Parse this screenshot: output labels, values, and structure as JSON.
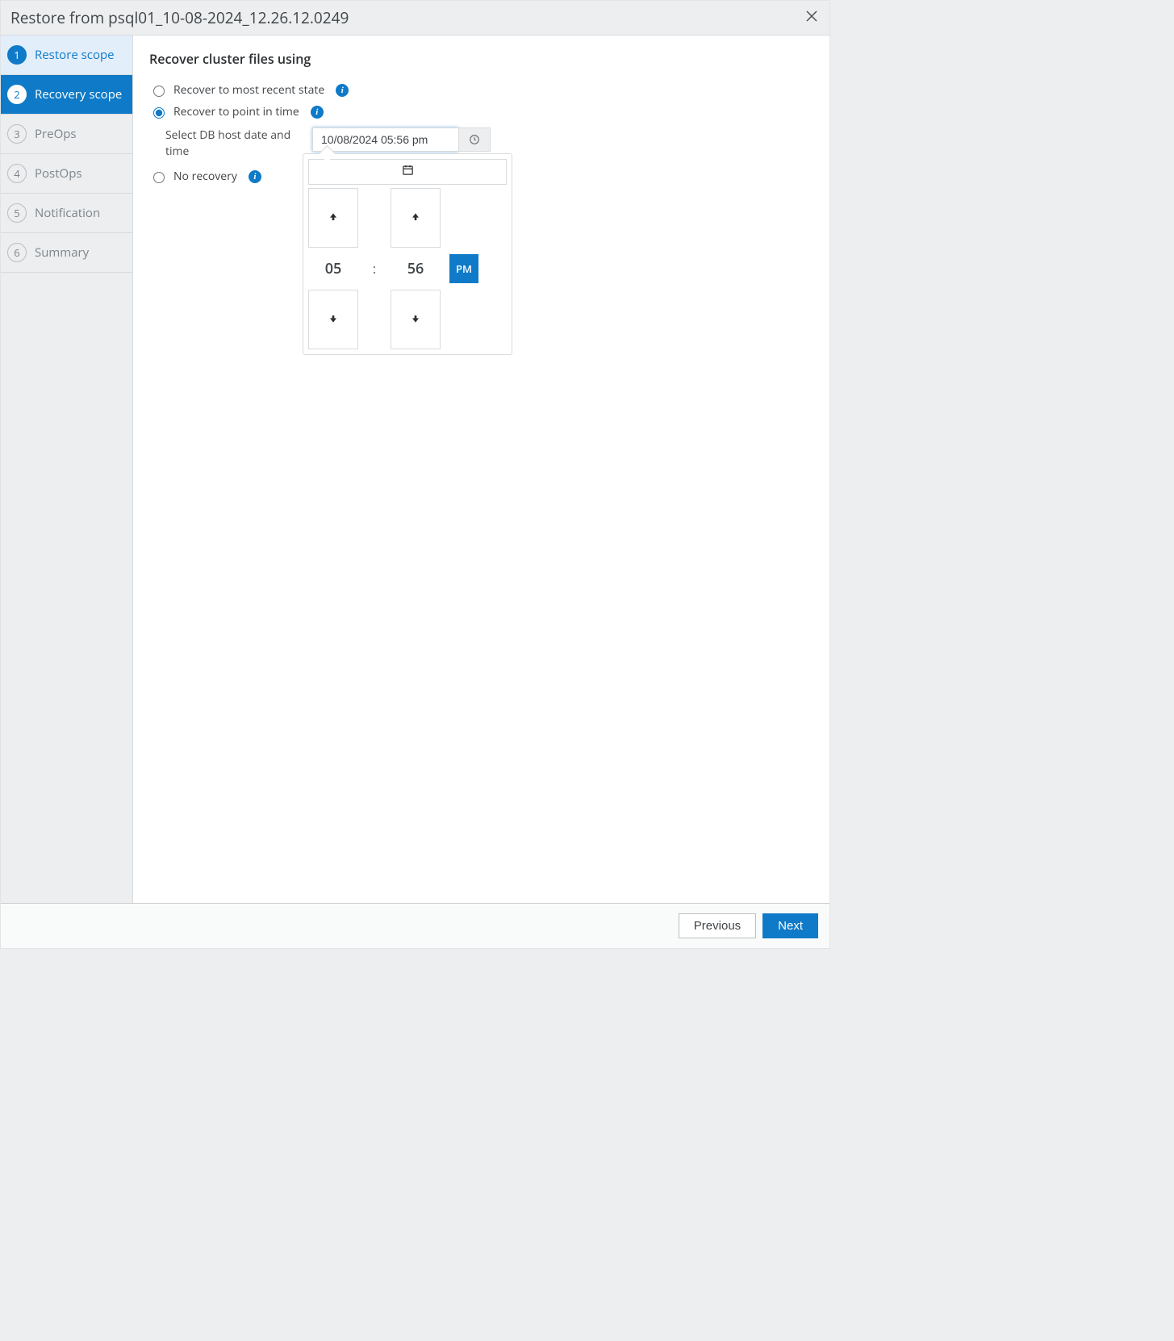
{
  "header": {
    "title": "Restore from psql01_10-08-2024_12.26.12.0249"
  },
  "sidebar": {
    "steps": [
      {
        "num": "1",
        "label": "Restore scope",
        "state": "completed"
      },
      {
        "num": "2",
        "label": "Recovery scope",
        "state": "active"
      },
      {
        "num": "3",
        "label": "PreOps",
        "state": "pending"
      },
      {
        "num": "4",
        "label": "PostOps",
        "state": "pending"
      },
      {
        "num": "5",
        "label": "Notification",
        "state": "pending"
      },
      {
        "num": "6",
        "label": "Summary",
        "state": "pending"
      }
    ]
  },
  "main": {
    "heading": "Recover cluster files using",
    "options": {
      "most_recent": "Recover to most recent state",
      "point_in_time": "Recover to point in time",
      "no_recovery": "No recovery"
    },
    "selected": "point_in_time",
    "datetime": {
      "sub_label": "Select DB host date and time",
      "value": "10/08/2024 05:56 pm"
    },
    "timepicker": {
      "hour": "05",
      "minute": "56",
      "ampm": "PM"
    }
  },
  "footer": {
    "previous": "Previous",
    "next": "Next"
  }
}
